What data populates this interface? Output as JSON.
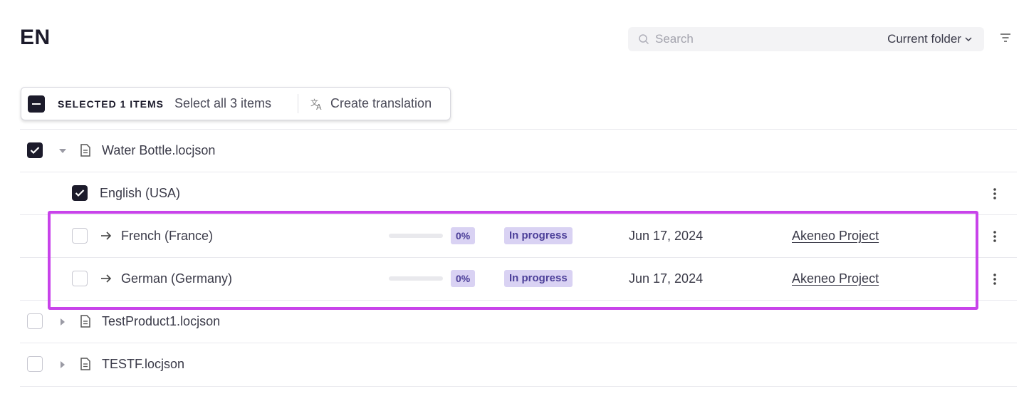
{
  "page": {
    "title": "EN"
  },
  "search": {
    "placeholder": "Search",
    "scope": "Current folder",
    "icon": "search-icon"
  },
  "filter": {
    "icon": "filter-icon"
  },
  "selection": {
    "count_label": "SELECTED 1 ITEMS",
    "select_all_label": "Select all 3 items",
    "create_translation_label": "Create translation"
  },
  "files": [
    {
      "name": "Water Bottle.locjson",
      "checked": true,
      "expanded": true
    },
    {
      "name": "TestProduct1.locjson",
      "checked": false,
      "expanded": false
    },
    {
      "name": "TESTF.locjson",
      "checked": false,
      "expanded": false
    }
  ],
  "source_locale": {
    "name": "English (USA)",
    "checked": true
  },
  "translations": [
    {
      "name": "French (France)",
      "progress": 0,
      "progress_label": "0%",
      "status": "In progress",
      "date": "Jun 17, 2024",
      "project": "Akeneo Project",
      "checked": false
    },
    {
      "name": "German (Germany)",
      "progress": 0,
      "progress_label": "0%",
      "status": "In progress",
      "date": "Jun 17, 2024",
      "project": "Akeneo Project",
      "checked": false
    }
  ],
  "colors": {
    "accent": "#1c1b2b",
    "badge_bg": "#d9d2f3",
    "badge_text": "#4c3f99",
    "highlight": "#c843ea"
  }
}
